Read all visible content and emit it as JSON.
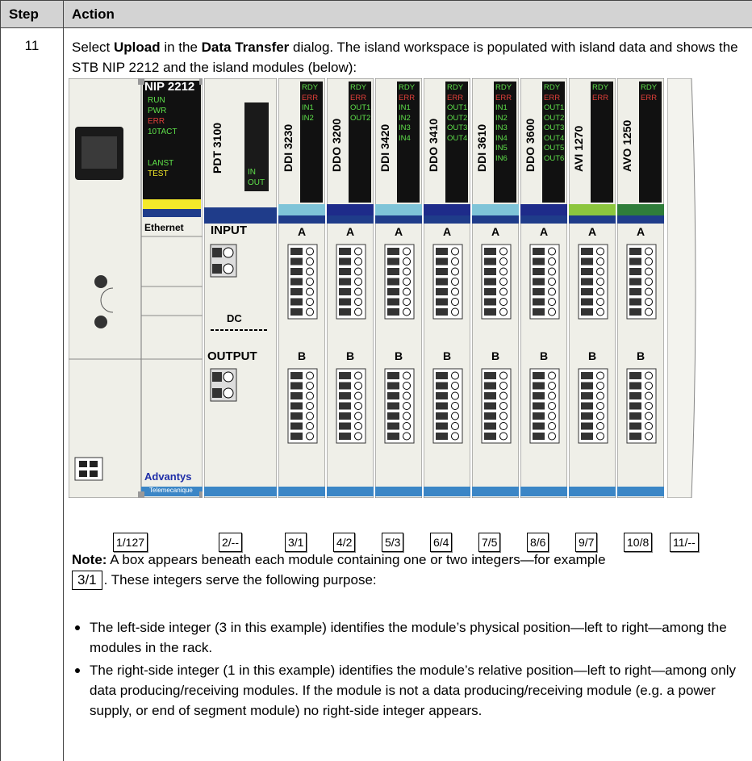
{
  "table": {
    "header": {
      "step": "Step",
      "action": "Action"
    },
    "row": {
      "step": "11",
      "intro": {
        "prefix": "Select ",
        "upload": "Upload",
        "middle": " in the ",
        "dialog": "Data Transfer",
        "suffix": " dialog. The island workspace is populated with island data and shows the STB NIP 2212 and the island modules (below):"
      }
    }
  },
  "island": {
    "nim": {
      "title": "NIP 2212",
      "leds": [
        "RUN",
        "PWR",
        "ERR",
        "10TACT",
        "LANST",
        "TEST"
      ],
      "ethernet": "Ethernet",
      "brand": "Advantys",
      "maker": "Telemecanique",
      "address": "1/127"
    },
    "power": {
      "title": "PDT 3100",
      "leds": [
        "IN",
        "OUT"
      ],
      "input": "INPUT",
      "dc": "DC",
      "output": "OUTPUT",
      "address": "2/--"
    },
    "modules": [
      {
        "name": "DDI 3230",
        "leds": [
          "RDY",
          "ERR",
          "IN1",
          "IN2"
        ],
        "address": "3/1",
        "accent": "#7fc4d8"
      },
      {
        "name": "DDO 3200",
        "leds": [
          "RDY",
          "ERR",
          "OUT1",
          "OUT2"
        ],
        "address": "4/2",
        "accent": "#1e2b8a"
      },
      {
        "name": "DDI 3420",
        "leds": [
          "RDY",
          "ERR",
          "IN1",
          "IN2",
          "IN3",
          "IN4"
        ],
        "address": "5/3",
        "accent": "#7fc4d8"
      },
      {
        "name": "DDO 3410",
        "leds": [
          "RDY",
          "ERR",
          "OUT1",
          "OUT2",
          "OUT3",
          "OUT4"
        ],
        "address": "6/4",
        "accent": "#1e2b8a"
      },
      {
        "name": "DDI 3610",
        "leds": [
          "RDY",
          "ERR",
          "IN1",
          "IN2",
          "IN3",
          "IN4",
          "IN5",
          "IN6"
        ],
        "address": "7/5",
        "accent": "#7fc4d8"
      },
      {
        "name": "DDO 3600",
        "leds": [
          "RDY",
          "ERR",
          "OUT1",
          "OUT2",
          "OUT3",
          "OUT4",
          "OUT5",
          "OUT6"
        ],
        "address": "8/6",
        "accent": "#1e2b8a"
      },
      {
        "name": "AVI 1270",
        "leds": [
          "RDY",
          "ERR"
        ],
        "address": "9/7",
        "accent": "#8cc63e"
      },
      {
        "name": "AVO 1250",
        "leds": [
          "RDY",
          "ERR"
        ],
        "address": "10/8",
        "accent": "#2f7d3a"
      }
    ],
    "terminal_a": "A",
    "terminal_b": "B",
    "end": {
      "address": "11/--"
    }
  },
  "note": {
    "label": "Note:",
    "text1": " A box appears beneath each module containing one or two integers—for example",
    "example": "3/1",
    "text2": ". These integers serve the following purpose:"
  },
  "bullets": [
    "The left-side integer (3 in this example) identifies the module’s physical position—left to right—among the modules in the rack.",
    "The right-side integer (1 in this example) identifies the module’s relative position—left to right—among only data producing/receiving modules. If the module is not a data producing/receiving module (e.g. a power supply, or end of segment module) no right-side integer appears."
  ]
}
